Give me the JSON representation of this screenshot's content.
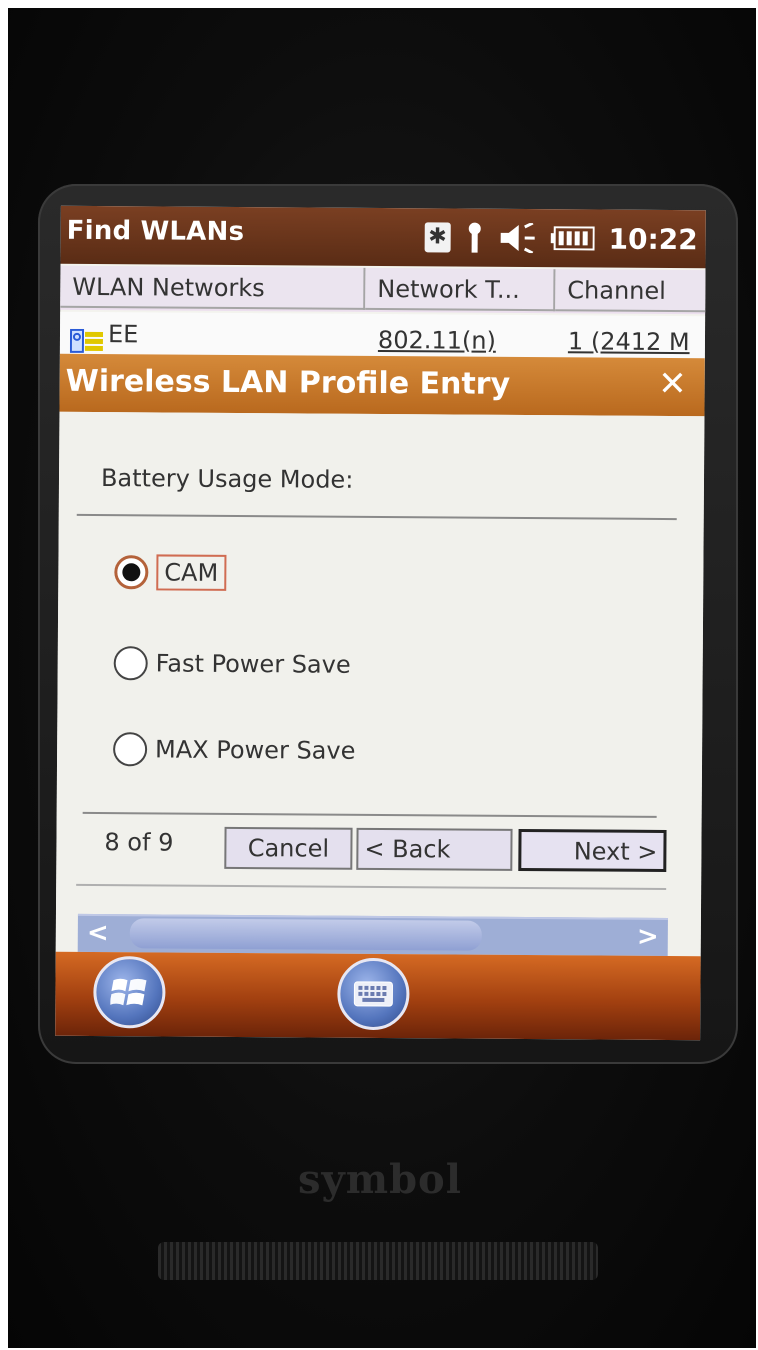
{
  "status_bar": {
    "app_title": "Find WLANs",
    "clock": "10:22",
    "icons": [
      "bluetooth-icon",
      "antenna-icon",
      "volume-icon",
      "battery-icon"
    ]
  },
  "list": {
    "columns": [
      "WLAN Networks",
      "Network T...",
      "Channel"
    ],
    "rows": [
      {
        "name": "EE",
        "network_type": "802.11(n)",
        "channel": "1 (2412 M"
      }
    ]
  },
  "dialog": {
    "title": "Wireless LAN Profile Entry",
    "close": "✕",
    "field_label": "Battery Usage Mode:",
    "options": [
      {
        "label": "CAM",
        "selected": true
      },
      {
        "label": "Fast Power Save",
        "selected": false
      },
      {
        "label": "MAX Power Save",
        "selected": false
      }
    ],
    "page_count": "8 of 9",
    "buttons": {
      "cancel": "Cancel",
      "back": "< Back",
      "next": "Next >"
    }
  },
  "scrollbar": {
    "left_arrow": "<",
    "right_arrow": ">"
  },
  "device": {
    "brand": "symbol"
  },
  "colors": {
    "title_bar": "#6a3419",
    "dialog_title": "#c77a2c",
    "taskbar": "#b84f16",
    "button_bg": "#e4e0ee"
  }
}
